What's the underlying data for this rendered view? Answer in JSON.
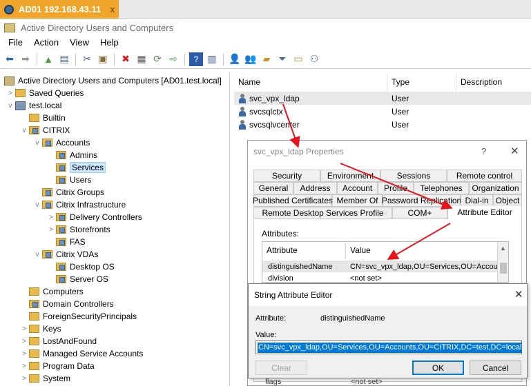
{
  "vm_tab": {
    "title": "AD01 192.168.43.11",
    "close": "x"
  },
  "window": {
    "title": "Active Directory Users and Computers"
  },
  "menu": [
    "File",
    "Action",
    "View",
    "Help"
  ],
  "tree": {
    "root": "Active Directory Users and Computers [AD01.test.local]",
    "saved_queries": "Saved Queries",
    "domain": "test.local",
    "builtin": "Builtin",
    "citrix": "CITRIX",
    "accounts": "Accounts",
    "admins": "Admins",
    "services": "Services",
    "users": "Users",
    "citrix_groups": "Citrix Groups",
    "citrix_infrastructure": "Citrix Infrastructure",
    "delivery_controllers": "Delivery Controllers",
    "storefronts": "Storefronts",
    "fas": "FAS",
    "citrix_vdas": "Citrix VDAs",
    "desktop_os": "Desktop OS",
    "server_os": "Server OS",
    "computers": "Computers",
    "domain_controllers": "Domain Controllers",
    "fsp": "ForeignSecurityPrincipals",
    "keys": "Keys",
    "lost_and_found": "LostAndFound",
    "msa": "Managed Service Accounts",
    "program_data": "Program Data",
    "system": "System"
  },
  "list": {
    "headers": {
      "name": "Name",
      "type": "Type",
      "description": "Description"
    },
    "rows": [
      {
        "name": "svc_vpx_ldap",
        "type": "User"
      },
      {
        "name": "svcsqlctx",
        "type": "User"
      },
      {
        "name": "svcsqlvcenter",
        "type": "User"
      }
    ]
  },
  "props": {
    "title": "svc_vpx_ldap Properties",
    "help": "?",
    "close": "✕",
    "tabs": {
      "security": "Security",
      "environment": "Environment",
      "sessions": "Sessions",
      "remote_control": "Remote control",
      "general": "General",
      "address": "Address",
      "account": "Account",
      "profile": "Profile",
      "telephones": "Telephones",
      "organization": "Organization",
      "published_certificates": "Published Certificates",
      "member_of": "Member Of",
      "password_replication": "Password Replication",
      "dial_in": "Dial-in",
      "object": "Object",
      "rdsp": "Remote Desktop Services Profile",
      "com": "COM+",
      "attribute_editor": "Attribute Editor"
    },
    "attributes_label": "Attributes:",
    "grid_headers": {
      "attribute": "Attribute",
      "value": "Value"
    },
    "grid_rows": [
      {
        "attribute": "distinguishedName",
        "value": "CN=svc_vpx_ldap,OU=Services,OU=Accounts"
      },
      {
        "attribute": "division",
        "value": "<not set>"
      }
    ],
    "flags_row": {
      "attribute": "flags",
      "value": "<not set>"
    }
  },
  "sae": {
    "title": "String Attribute Editor",
    "close": "✕",
    "attribute_label": "Attribute:",
    "attribute_value": "distinguishedName",
    "value_label": "Value:",
    "value": "CN=svc_vpx_ldap,OU=Services,OU=Accounts,OU=CITRIX,DC=test,DC=local",
    "clear": "Clear",
    "ok": "OK",
    "cancel": "Cancel"
  },
  "colors": {
    "vm_tab": "#f2a52b",
    "selection": "#0078d7",
    "arrow": "#e8141c"
  }
}
